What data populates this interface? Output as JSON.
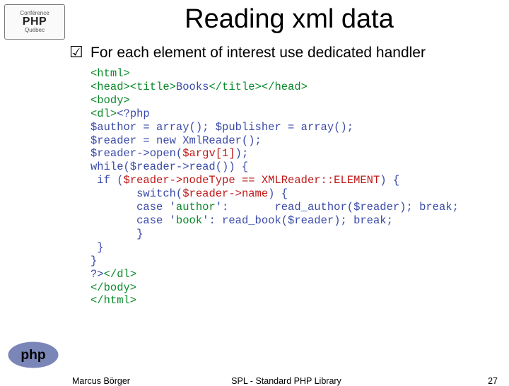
{
  "logo": {
    "line1": "Conférence",
    "line2": "PHP",
    "line3": "Québec"
  },
  "title": "Reading xml data",
  "bullet": "For each element of interest use dedicated handler",
  "code": {
    "l1": "<html>",
    "l2a": "<head><title>",
    "l2b": "Books",
    "l2c": "</title></head>",
    "l3": "<body>",
    "l4a": "<dl>",
    "l4b": "<?php",
    "l5": "$author = array(); $publisher = array();",
    "l6": "$reader = new XmlReader();",
    "l7a": "$reader->open(",
    "l7b": "$argv[1]",
    "l7c": ");",
    "l8": "while($reader->read()) {",
    "l9a": " if (",
    "l9b": "$reader->nodeType == XMLReader::ELEMENT",
    "l9c": ") {",
    "l10a": "       switch(",
    "l10b": "$reader->name",
    "l10c": ") {",
    "l11a": "       case '",
    "l11b": "author",
    "l11c": "':       read_author($reader); break;",
    "l12a": "       case '",
    "l12b": "book",
    "l12c": "': read_book($reader); break;",
    "l13": "       }",
    "l14": " }",
    "l15": "}",
    "l16a": "?>",
    "l16b": "</dl>",
    "l17": "</body>",
    "l18": "</html>"
  },
  "footer": {
    "author": "Marcus Börger",
    "mid": "SPL - Standard PHP Library",
    "page": "27"
  }
}
